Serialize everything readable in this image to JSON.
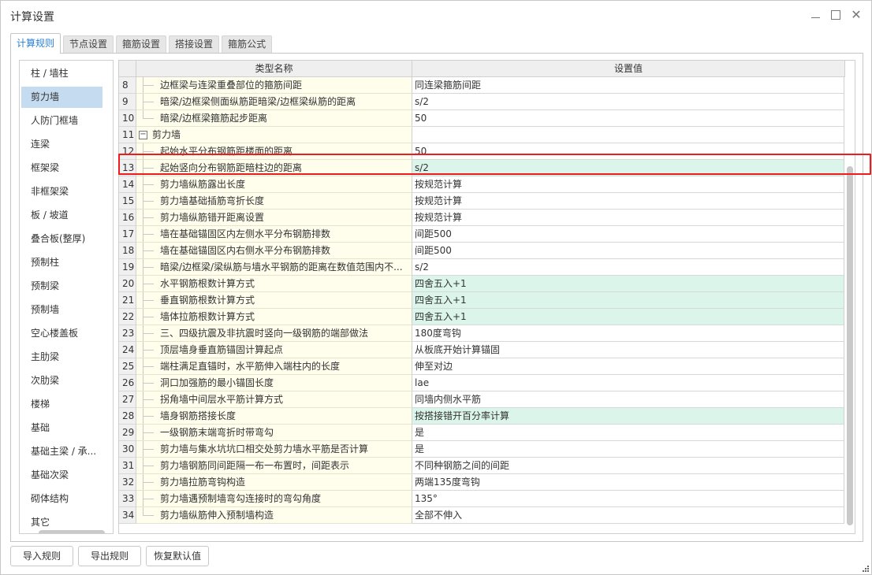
{
  "window": {
    "title": "计算设置",
    "minimize": "minimize",
    "maximize": "maximize",
    "close_glyph": "✕"
  },
  "tabs": [
    {
      "label": "计算规则",
      "active": true
    },
    {
      "label": "节点设置",
      "active": false
    },
    {
      "label": "箍筋设置",
      "active": false
    },
    {
      "label": "搭接设置",
      "active": false
    },
    {
      "label": "箍筋公式",
      "active": false
    }
  ],
  "sidebar": {
    "items": [
      {
        "label": "柱 / 墙柱"
      },
      {
        "label": "剪力墙",
        "selected": true
      },
      {
        "label": "人防门框墙"
      },
      {
        "label": "连梁"
      },
      {
        "label": "框架梁"
      },
      {
        "label": "非框架梁"
      },
      {
        "label": "板 / 坡道"
      },
      {
        "label": "叠合板(整厚)"
      },
      {
        "label": "预制柱"
      },
      {
        "label": "预制梁"
      },
      {
        "label": "预制墙"
      },
      {
        "label": "空心楼盖板"
      },
      {
        "label": "主肋梁"
      },
      {
        "label": "次肋梁"
      },
      {
        "label": "楼梯"
      },
      {
        "label": "基础"
      },
      {
        "label": "基础主梁 / 承..."
      },
      {
        "label": "基础次梁"
      },
      {
        "label": "砌体结构"
      },
      {
        "label": "其它"
      }
    ]
  },
  "grid": {
    "columns": {
      "name": "类型名称",
      "value": "设置值"
    },
    "rows": [
      {
        "num": "8",
        "name": "边框梁与连梁重叠部位的箍筋间距",
        "value": "同连梁箍筋间距",
        "type": "child"
      },
      {
        "num": "9",
        "name": "暗梁/边框梁侧面纵筋距暗梁/边框梁纵筋的距离",
        "value": "s/2",
        "type": "child"
      },
      {
        "num": "10",
        "name": "暗梁/边框梁箍筋起步距离",
        "value": "50",
        "type": "child-last"
      },
      {
        "num": "11",
        "name": "剪力墙",
        "value": "",
        "type": "group",
        "toggle": "−"
      },
      {
        "num": "12",
        "name": "起始水平分布钢筋距楼面的距离",
        "value": "50",
        "type": "child"
      },
      {
        "num": "13",
        "name": "起始竖向分布钢筋距暗柱边的距离",
        "value": "s/2",
        "type": "child",
        "modified": true,
        "highlighted": true
      },
      {
        "num": "14",
        "name": "剪力墙纵筋露出长度",
        "value": "按规范计算",
        "type": "child"
      },
      {
        "num": "15",
        "name": "剪力墙基础插筋弯折长度",
        "value": "按规范计算",
        "type": "child"
      },
      {
        "num": "16",
        "name": "剪力墙纵筋错开距离设置",
        "value": "按规范计算",
        "type": "child"
      },
      {
        "num": "17",
        "name": "墙在基础锚固区内左侧水平分布钢筋排数",
        "value": "间距500",
        "type": "child"
      },
      {
        "num": "18",
        "name": "墙在基础锚固区内右侧水平分布钢筋排数",
        "value": "间距500",
        "type": "child"
      },
      {
        "num": "19",
        "name": "暗梁/边框梁/梁纵筋与墙水平钢筋的距离在数值范围内不...",
        "value": "s/2",
        "type": "child"
      },
      {
        "num": "20",
        "name": "水平钢筋根数计算方式",
        "value": "四舍五入+1",
        "type": "child",
        "modified": true
      },
      {
        "num": "21",
        "name": "垂直钢筋根数计算方式",
        "value": "四舍五入+1",
        "type": "child",
        "modified": true
      },
      {
        "num": "22",
        "name": "墙体拉筋根数计算方式",
        "value": "四舍五入+1",
        "type": "child",
        "modified": true
      },
      {
        "num": "23",
        "name": "三、四级抗震及非抗震时竖向一级钢筋的端部做法",
        "value": "180度弯钩",
        "type": "child"
      },
      {
        "num": "24",
        "name": "顶层墙身垂直筋锚固计算起点",
        "value": "从板底开始计算锚固",
        "type": "child"
      },
      {
        "num": "25",
        "name": "端柱满足直锚时，水平筋伸入端柱内的长度",
        "value": "伸至对边",
        "type": "child"
      },
      {
        "num": "26",
        "name": "洞口加强筋的最小锚固长度",
        "value": "lae",
        "type": "child"
      },
      {
        "num": "27",
        "name": "拐角墙中间层水平筋计算方式",
        "value": "同墙内侧水平筋",
        "type": "child"
      },
      {
        "num": "28",
        "name": "墙身钢筋搭接长度",
        "value": "按搭接错开百分率计算",
        "type": "child",
        "modified": true
      },
      {
        "num": "29",
        "name": "一级钢筋末端弯折时带弯勾",
        "value": "是",
        "type": "child"
      },
      {
        "num": "30",
        "name": "剪力墙与集水坑坑口相交处剪力墙水平筋是否计算",
        "value": "是",
        "type": "child"
      },
      {
        "num": "31",
        "name": "剪力墙钢筋同间距隔一布一布置时，间距表示",
        "value": "不同种钢筋之间的间距",
        "type": "child"
      },
      {
        "num": "32",
        "name": "剪力墙拉筋弯钩构造",
        "value": "两端135度弯钩",
        "type": "child"
      },
      {
        "num": "33",
        "name": "剪力墙遇预制墙弯勾连接时的弯勾角度",
        "value": "135°",
        "type": "child"
      },
      {
        "num": "34",
        "name": "剪力墙纵筋伸入预制墙构造",
        "value": "全部不伸入",
        "type": "child-last"
      }
    ]
  },
  "colors": {
    "name_cell_bg": "#fffdec",
    "modified_value_bg": "#dcf5ea",
    "selected_sidebar_bg": "#c4dbf0",
    "highlight_border": "#ee1c1c",
    "active_tab_text": "#2a7fd4"
  },
  "buttons": {
    "import": "导入规则",
    "export": "导出规则",
    "restore": "恢复默认值"
  }
}
